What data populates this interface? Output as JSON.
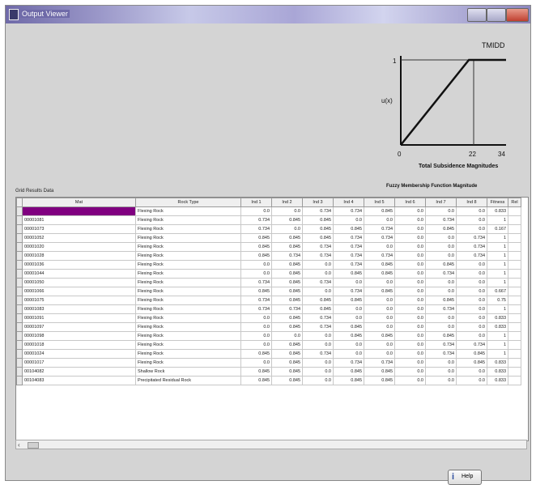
{
  "window": {
    "title": "Output Viewer"
  },
  "chart": {
    "tmidd_label": "TMIDD",
    "y_label": "u(x)",
    "y_tick": "1",
    "x_ticks": [
      "0",
      "22",
      "34"
    ],
    "x_axis_label": "Total Subsidence Magnitudes",
    "caption": "Fuzzy Membership Function Magnitude",
    "chart_data": {
      "type": "line",
      "title": "TMIDD",
      "xlabel": "Total Subsidence Magnitudes",
      "ylabel": "u(x)",
      "xlim": [
        0,
        34
      ],
      "ylim": [
        0,
        1
      ],
      "series": [
        {
          "x": [
            0,
            22,
            34
          ],
          "y": [
            0,
            1,
            1
          ]
        }
      ]
    }
  },
  "grid": {
    "label": "Grid Results Data",
    "columns": [
      "Mat",
      "Rock Type",
      "Ind 1",
      "Ind 2",
      "Ind 3",
      "Ind 4",
      "Ind 5",
      "Ind 6",
      "Ind 7",
      "Ind 8",
      "Fitness",
      "Rel"
    ],
    "rows": [
      [
        "",
        "Flexing Rock",
        "0.0",
        "0.0",
        "0.734",
        "0.734",
        "0.845",
        "0.0",
        "0.0",
        "0.0",
        "0.833",
        ""
      ],
      [
        "00001081",
        "Flexing Rock",
        "0.734",
        "0.845",
        "0.845",
        "0.0",
        "0.0",
        "0.0",
        "0.734",
        "0.0",
        "1",
        ""
      ],
      [
        "00001073",
        "Flexing Rock",
        "0.734",
        "0.0",
        "0.845",
        "0.845",
        "0.734",
        "0.0",
        "0.845",
        "0.0",
        "0.167",
        ""
      ],
      [
        "00001052",
        "Flexing Rock",
        "0.845",
        "0.845",
        "0.845",
        "0.734",
        "0.734",
        "0.0",
        "0.0",
        "0.734",
        "1",
        ""
      ],
      [
        "00001020",
        "Flexing Rock",
        "0.845",
        "0.845",
        "0.734",
        "0.734",
        "0.0",
        "0.0",
        "0.0",
        "0.734",
        "1",
        ""
      ],
      [
        "00001028",
        "Flexing Rock",
        "0.845",
        "0.734",
        "0.734",
        "0.734",
        "0.734",
        "0.0",
        "0.0",
        "0.734",
        "1",
        ""
      ],
      [
        "00001036",
        "Flexing Rock",
        "0.0",
        "0.845",
        "0.0",
        "0.734",
        "0.845",
        "0.0",
        "0.845",
        "0.0",
        "1",
        ""
      ],
      [
        "00001044",
        "Flexing Rock",
        "0.0",
        "0.845",
        "0.0",
        "0.845",
        "0.845",
        "0.0",
        "0.734",
        "0.0",
        "1",
        ""
      ],
      [
        "00001050",
        "Flexing Rock",
        "0.734",
        "0.845",
        "0.734",
        "0.0",
        "0.0",
        "0.0",
        "0.0",
        "0.0",
        "1",
        ""
      ],
      [
        "00001066",
        "Flexing Rock",
        "0.845",
        "0.845",
        "0.0",
        "0.734",
        "0.845",
        "0.0",
        "0.0",
        "0.0",
        "0.667",
        ""
      ],
      [
        "00001075",
        "Flexing Rock",
        "0.734",
        "0.845",
        "0.845",
        "0.845",
        "0.0",
        "0.0",
        "0.845",
        "0.0",
        "0.75",
        ""
      ],
      [
        "00001083",
        "Flexing Rock",
        "0.734",
        "0.734",
        "0.845",
        "0.0",
        "0.0",
        "0.0",
        "0.734",
        "0.0",
        "1",
        ""
      ],
      [
        "00001091",
        "Flexing Rock",
        "0.0",
        "0.845",
        "0.734",
        "0.0",
        "0.0",
        "0.0",
        "0.0",
        "0.0",
        "0.833",
        ""
      ],
      [
        "00001097",
        "Flexing Rock",
        "0.0",
        "0.845",
        "0.734",
        "0.845",
        "0.0",
        "0.0",
        "0.0",
        "0.0",
        "0.833",
        ""
      ],
      [
        "00001098",
        "Flexing Rock",
        "0.0",
        "0.0",
        "0.0",
        "0.845",
        "0.845",
        "0.0",
        "0.845",
        "0.0",
        "1",
        ""
      ],
      [
        "00001018",
        "Flexing Rock",
        "0.0",
        "0.845",
        "0.0",
        "0.0",
        "0.0",
        "0.0",
        "0.734",
        "0.734",
        "1",
        ""
      ],
      [
        "00001024",
        "Flexing Rock",
        "0.845",
        "0.845",
        "0.734",
        "0.0",
        "0.0",
        "0.0",
        "0.734",
        "0.845",
        "1",
        ""
      ],
      [
        "00001017",
        "Flexing Rock",
        "0.0",
        "0.845",
        "0.0",
        "0.734",
        "0.734",
        "0.0",
        "0.0",
        "0.845",
        "0.833",
        ""
      ],
      [
        "00104082",
        "Shallow Rock",
        "0.845",
        "0.845",
        "0.0",
        "0.845",
        "0.845",
        "0.0",
        "0.0",
        "0.0",
        "0.833",
        ""
      ],
      [
        "00104083",
        "Precipitated Residual Rock",
        "0.845",
        "0.845",
        "0.0",
        "0.845",
        "0.845",
        "0.0",
        "0.0",
        "0.0",
        "0.833",
        ""
      ]
    ]
  },
  "buttons": {
    "help": "Help"
  },
  "colors": {
    "selected": "#800080",
    "chart_line": "#111111"
  }
}
